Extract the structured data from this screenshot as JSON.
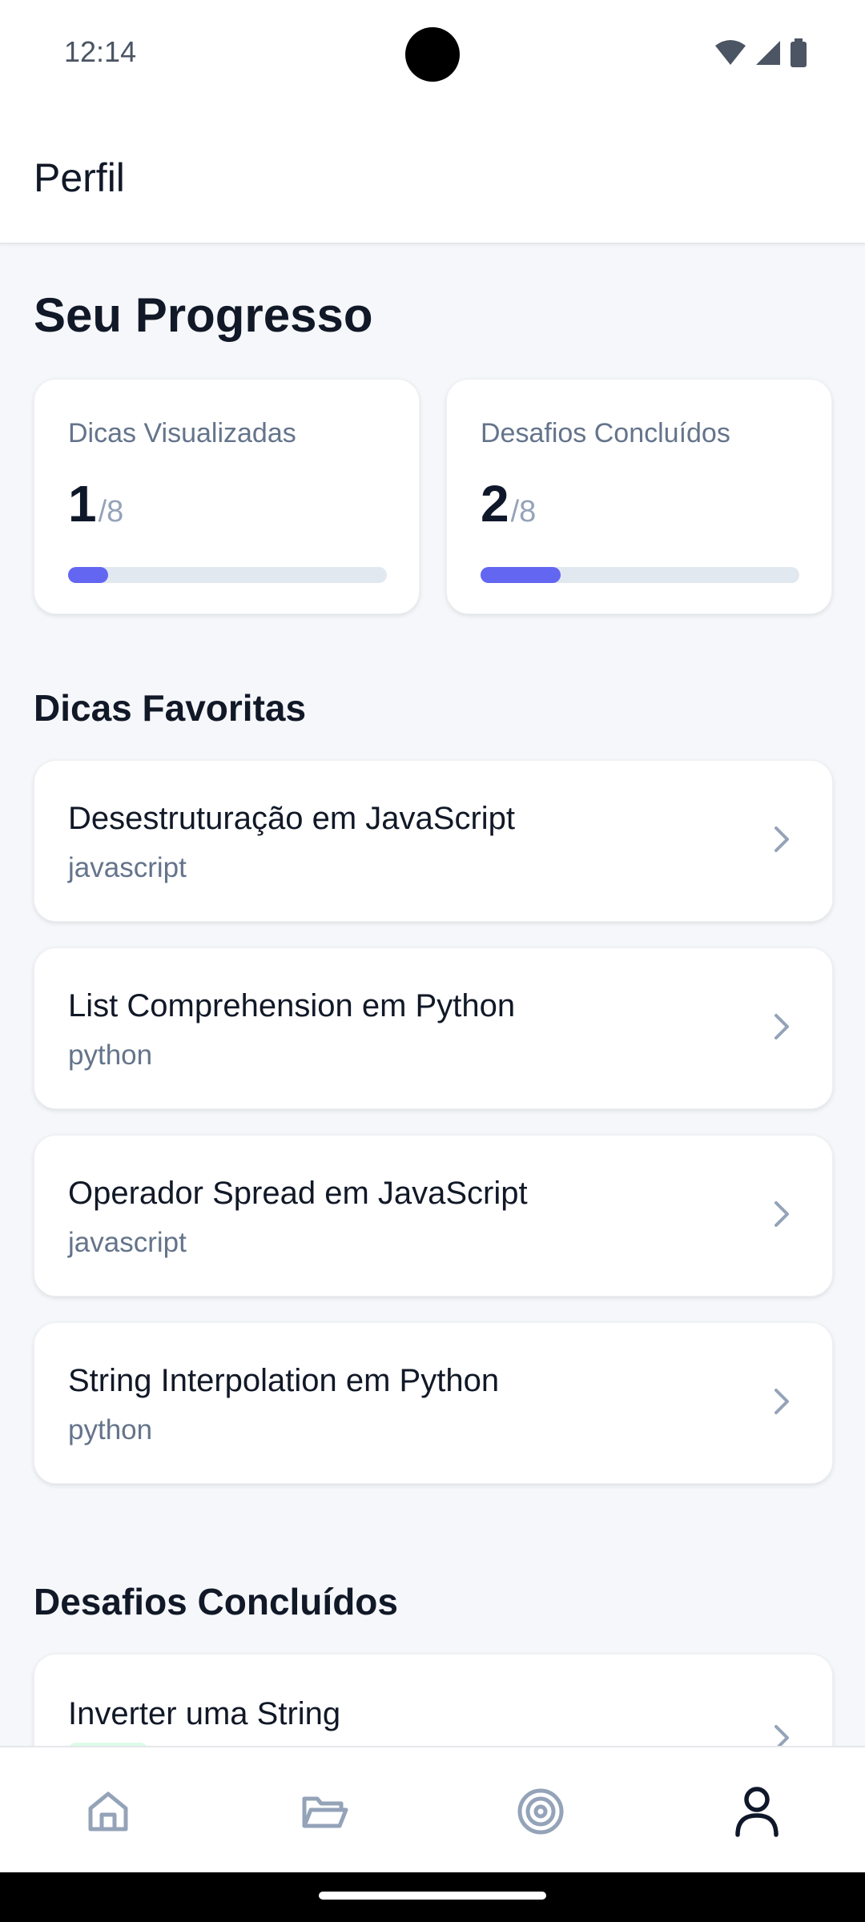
{
  "status_bar": {
    "time": "12:14"
  },
  "header": {
    "title": "Perfil"
  },
  "progress": {
    "heading": "Seu Progresso",
    "cards": [
      {
        "label": "Dicas Visualizadas",
        "value": "1",
        "total": "/8",
        "progress": 0.125
      },
      {
        "label": "Desafios Concluídos",
        "value": "2",
        "total": "/8",
        "progress": 0.25
      }
    ]
  },
  "favorites": {
    "heading": "Dicas Favoritas",
    "items": [
      {
        "title": "Desestruturação em JavaScript",
        "tag": "javascript"
      },
      {
        "title": "List Comprehension em Python",
        "tag": "python"
      },
      {
        "title": "Operador Spread em JavaScript",
        "tag": "javascript"
      },
      {
        "title": "String Interpolation em Python",
        "tag": "python"
      }
    ]
  },
  "completed": {
    "heading": "Desafios Concluídos",
    "items": [
      {
        "title": "Inverter uma String"
      }
    ]
  },
  "bottom_nav": {
    "items": [
      {
        "icon": "home-icon",
        "active": false
      },
      {
        "icon": "folder-icon",
        "active": false
      },
      {
        "icon": "target-icon",
        "active": false
      },
      {
        "icon": "profile-icon",
        "active": true
      }
    ]
  },
  "colors": {
    "accent": "#6366f1",
    "track": "#e2e8f0",
    "text": "#0f172a",
    "muted": "#64748b"
  }
}
